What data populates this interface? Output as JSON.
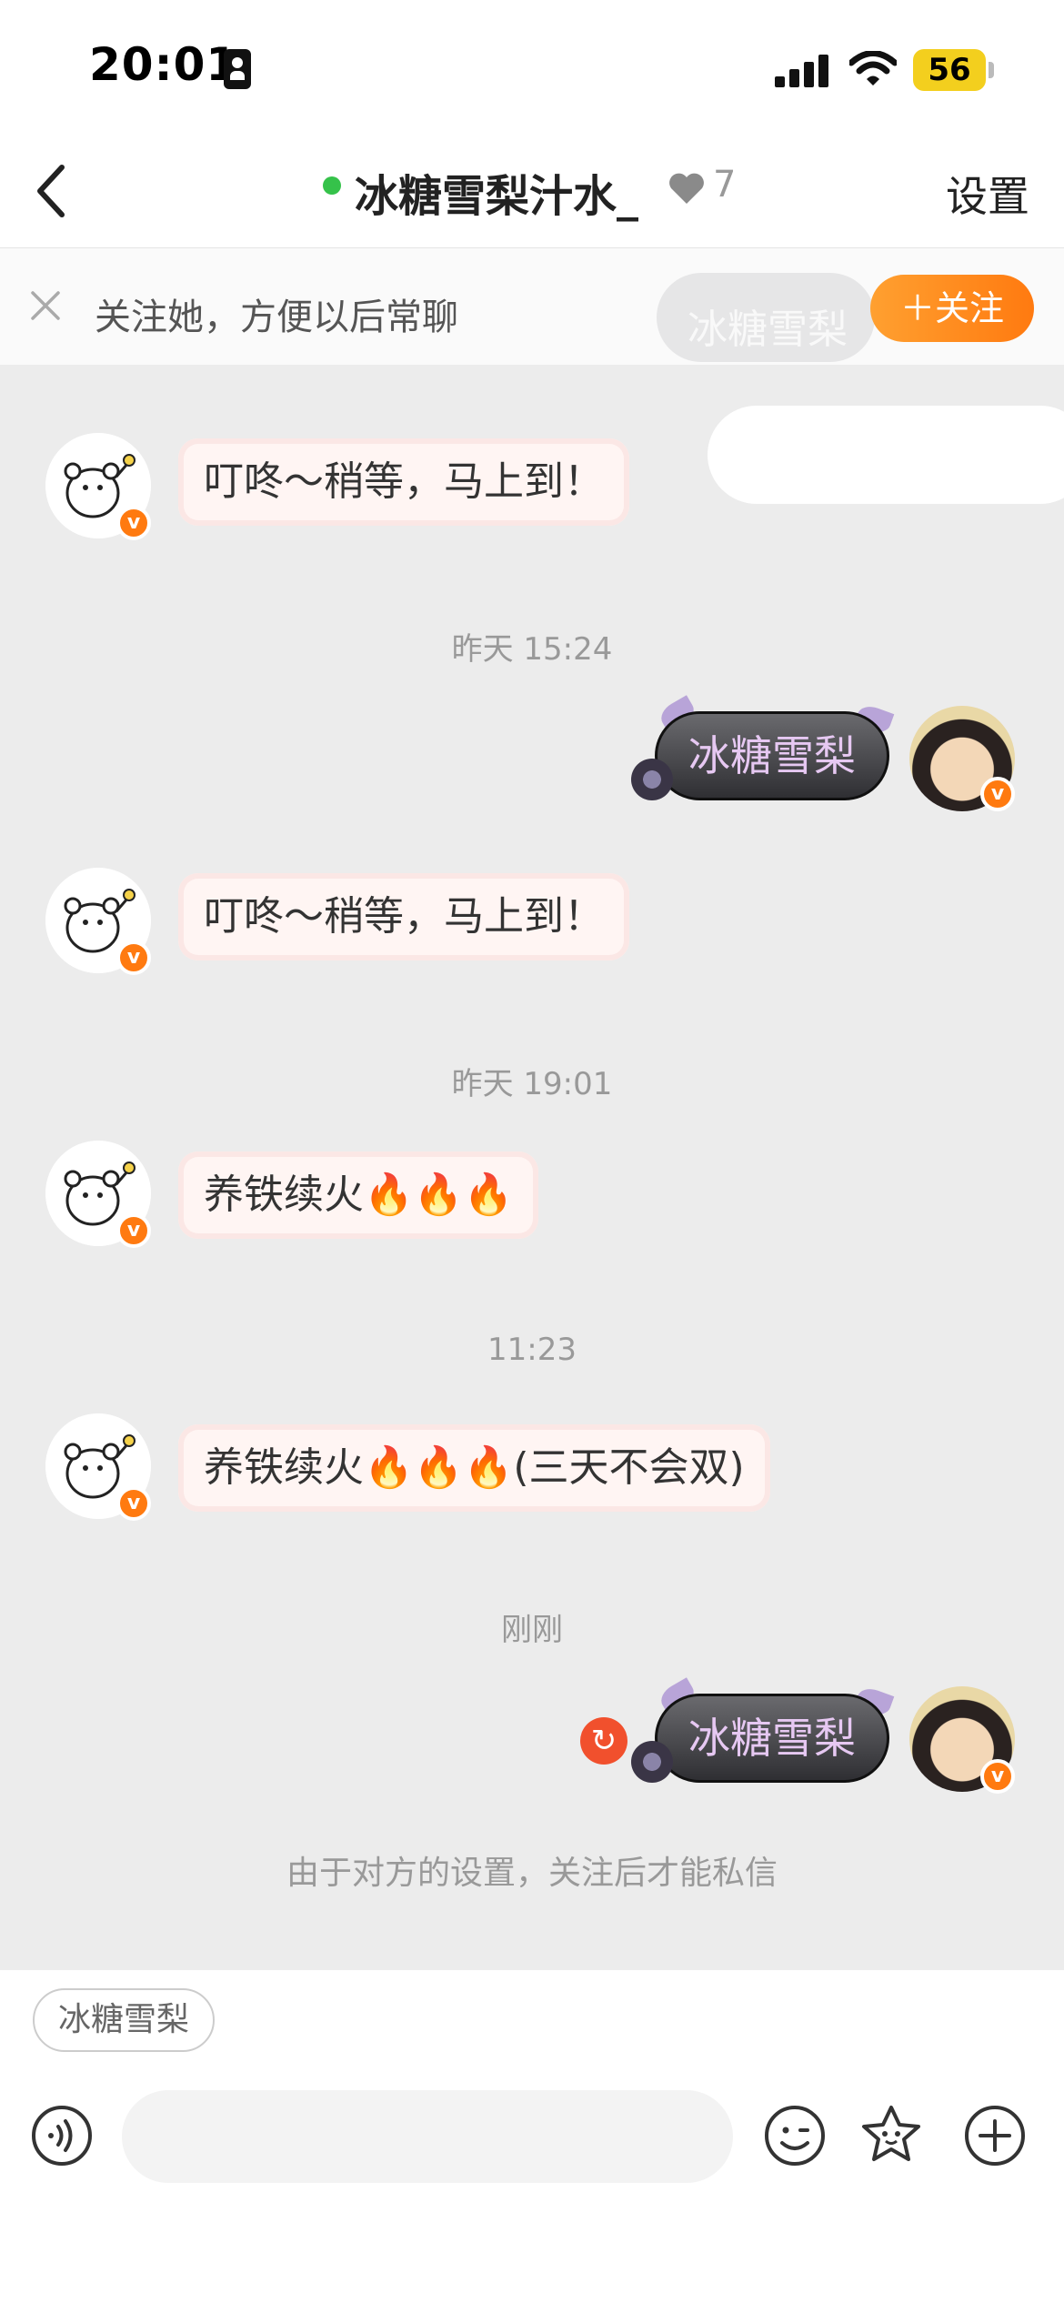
{
  "status_bar": {
    "time": "20:01",
    "battery": "56"
  },
  "header": {
    "title": "冰糖雪梨汁水_",
    "heart_count": "7",
    "settings_label": "设置"
  },
  "follow_banner": {
    "hint": "关注她，方便以后常聊",
    "follow_label": "＋关注",
    "ghost_text": "冰糖雪梨"
  },
  "messages": [
    {
      "side": "left",
      "text": "叮咚～稍等，马上到！"
    },
    {
      "type": "time",
      "text": "昨天 15:24"
    },
    {
      "side": "right",
      "text": "冰糖雪梨"
    },
    {
      "side": "left",
      "text": "叮咚～稍等，马上到！"
    },
    {
      "type": "time",
      "text": "昨天 19:01"
    },
    {
      "side": "left",
      "text": "养铁续火🔥🔥🔥"
    },
    {
      "type": "time",
      "text": "11:23"
    },
    {
      "side": "left",
      "text": "养铁续火🔥🔥🔥(三天不会双)"
    },
    {
      "type": "time",
      "text": "刚刚"
    },
    {
      "side": "right",
      "text": "冰糖雪梨"
    }
  ],
  "notice": "由于对方的设置，关注后才能私信",
  "quick_reply": "冰糖雪梨",
  "colors": {
    "accent": "#ff7a10",
    "online": "#35c24a",
    "retry": "#f1502d"
  }
}
